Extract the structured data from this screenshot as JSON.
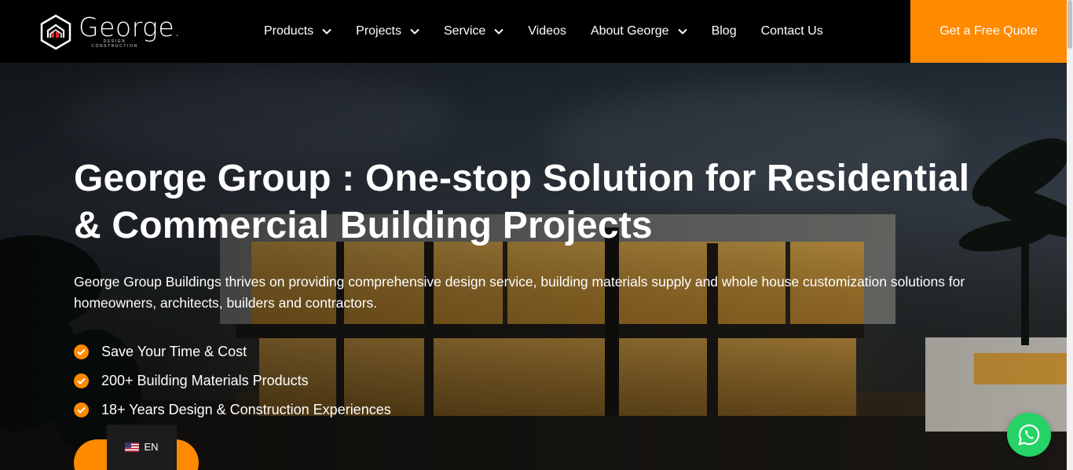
{
  "brand": {
    "name": "George",
    "dot": ".",
    "tagline_line1": "DESIGN",
    "tagline_line2": "CONSTRUCTION",
    "logo_icon": "house-hexagon-icon"
  },
  "nav": {
    "items": [
      {
        "label": "Products",
        "has_dropdown": true
      },
      {
        "label": "Projects",
        "has_dropdown": true
      },
      {
        "label": "Service",
        "has_dropdown": true
      },
      {
        "label": "Videos",
        "has_dropdown": false
      },
      {
        "label": "About George",
        "has_dropdown": true
      },
      {
        "label": "Blog",
        "has_dropdown": false
      },
      {
        "label": "Contact Us",
        "has_dropdown": false
      }
    ],
    "cta_label": "Get a Free Quote"
  },
  "hero": {
    "title": "George Group : One-stop Solution for Residential & Commercial Building Projects",
    "description": "George Group Buildings thrives on providing comprehensive design service, building materials supply and whole house customization solutions for homeowners, architects, builders and contractors.",
    "features": [
      "Save Your Time & Cost",
      "200+ Building Materials Products",
      "18+ Years Design & Construction Experiences"
    ],
    "feature_icon": "check-circle-icon"
  },
  "language": {
    "code": "EN",
    "flag_icon": "us-flag-icon"
  },
  "whatsapp": {
    "icon": "whatsapp-icon"
  },
  "colors": {
    "accent": "#ff8a00",
    "header_bg": "#000000",
    "whatsapp": "#25d366"
  }
}
